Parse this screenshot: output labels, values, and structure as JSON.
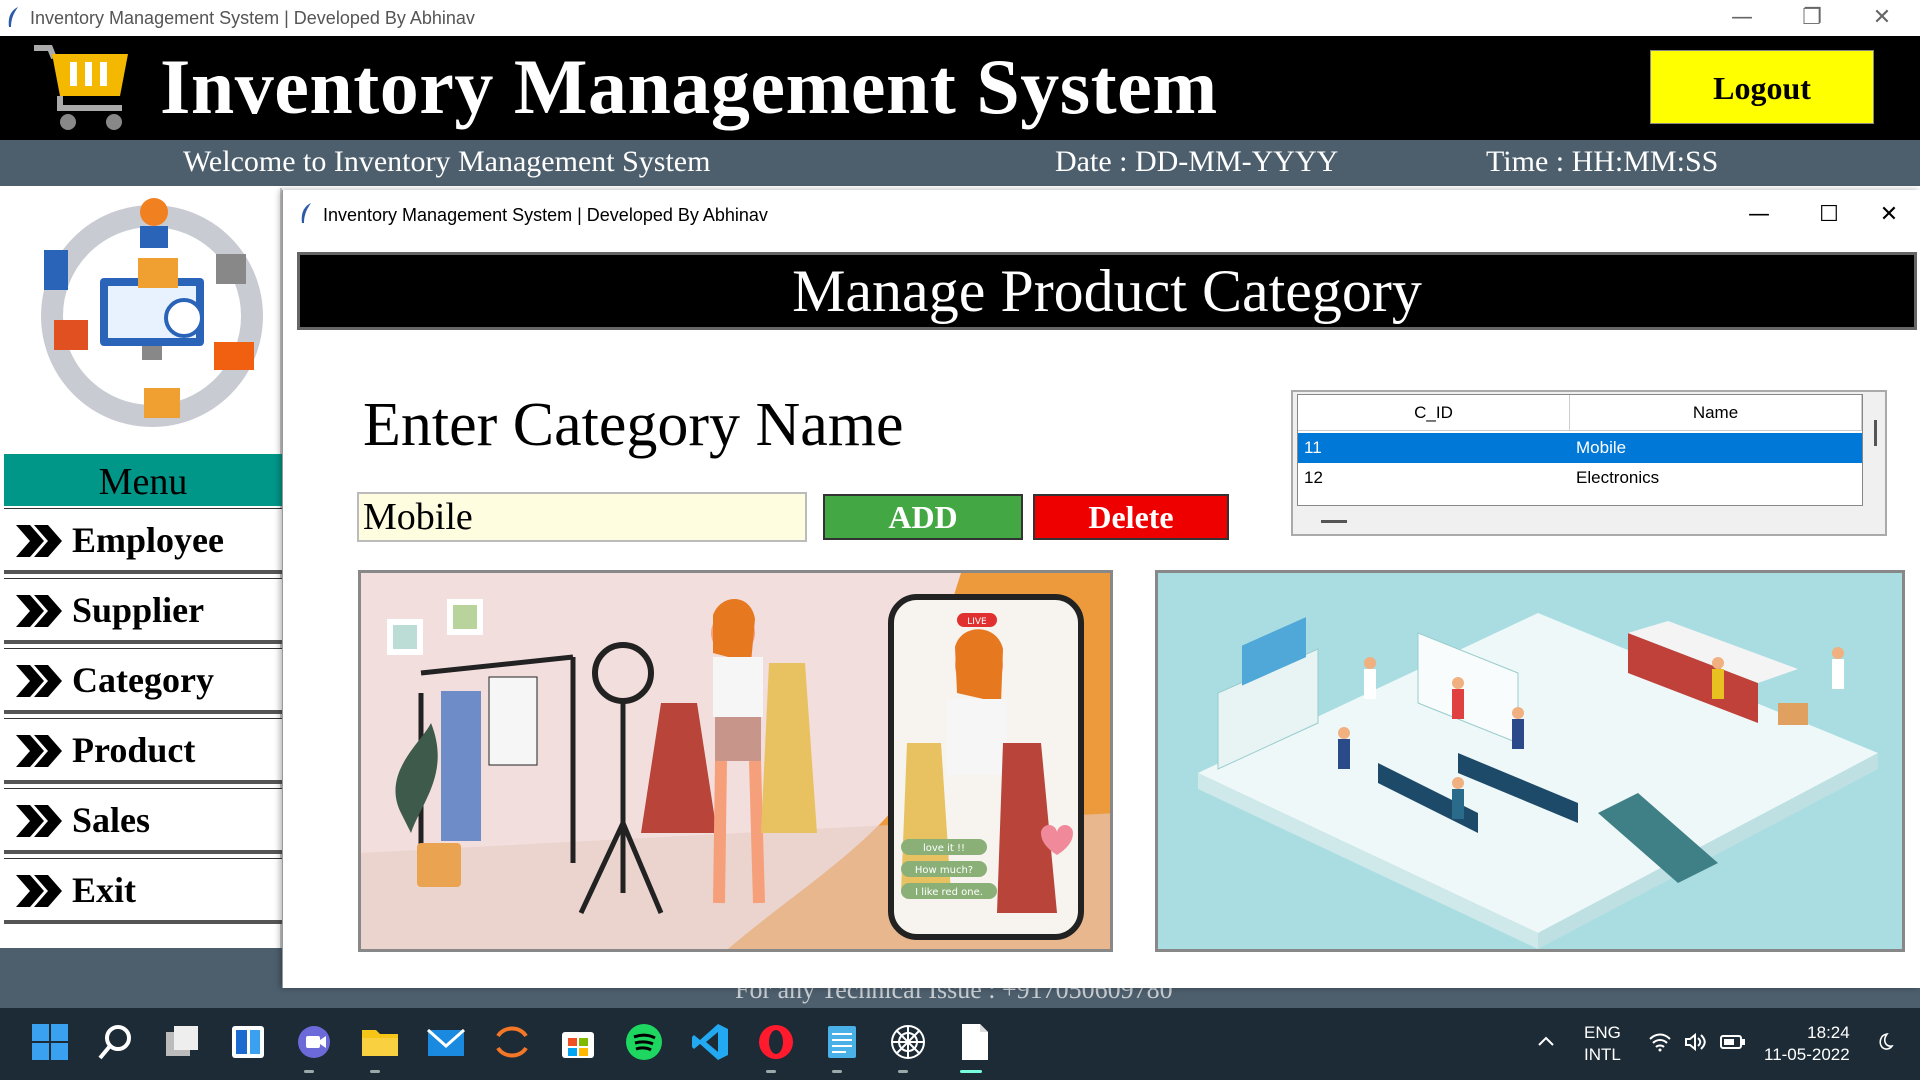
{
  "window": {
    "title": "Inventory Management System | Developed By Abhinav",
    "minimize": "—",
    "restore": "❐",
    "close": "✕"
  },
  "header": {
    "title": "Inventory Management System",
    "logout_label": "Logout"
  },
  "subheader": {
    "welcome": "Welcome to Inventory Management System",
    "date": "Date : DD-MM-YYYY",
    "time": "Time : HH:MM:SS"
  },
  "sidebar": {
    "menu_title": "Menu",
    "items": [
      {
        "label": "Employee"
      },
      {
        "label": "Supplier"
      },
      {
        "label": "Category"
      },
      {
        "label": "Product"
      },
      {
        "label": "Sales"
      },
      {
        "label": "Exit"
      }
    ]
  },
  "footer": {
    "text": "For any Technical Issue : +917050609780"
  },
  "child_window": {
    "title": "Inventory Management System | Developed By Abhinav",
    "minimize": "—",
    "maximize": "☐",
    "close": "✕",
    "banner": "Manage Product Category",
    "enter_label": "Enter Category Name",
    "input_value": "Mobile",
    "add_label": "ADD",
    "delete_label": "Delete",
    "table": {
      "columns": [
        "C_ID",
        "Name"
      ],
      "rows": [
        {
          "id": "11",
          "name": "Mobile",
          "selected": true
        },
        {
          "id": "12",
          "name": "Electronics",
          "selected": false
        }
      ]
    },
    "illustration_left": {
      "chat": [
        "love it !!",
        "How much?",
        "I like red one."
      ],
      "live_badge": "LIVE"
    }
  },
  "taskbar": {
    "lang_line1": "ENG",
    "lang_line2": "INTL",
    "time": "18:24",
    "date": "11-05-2022"
  },
  "colors": {
    "header_bg": "#000000",
    "subheader_bg": "#4d5f6d",
    "logout_bg": "#ffff00",
    "menu_title_bg": "#009688",
    "add_bg": "#43a843",
    "delete_bg": "#ee0000",
    "input_bg": "#fffde0",
    "selected_row": "#0078d7",
    "taskbar_bg": "#1c2b35"
  }
}
